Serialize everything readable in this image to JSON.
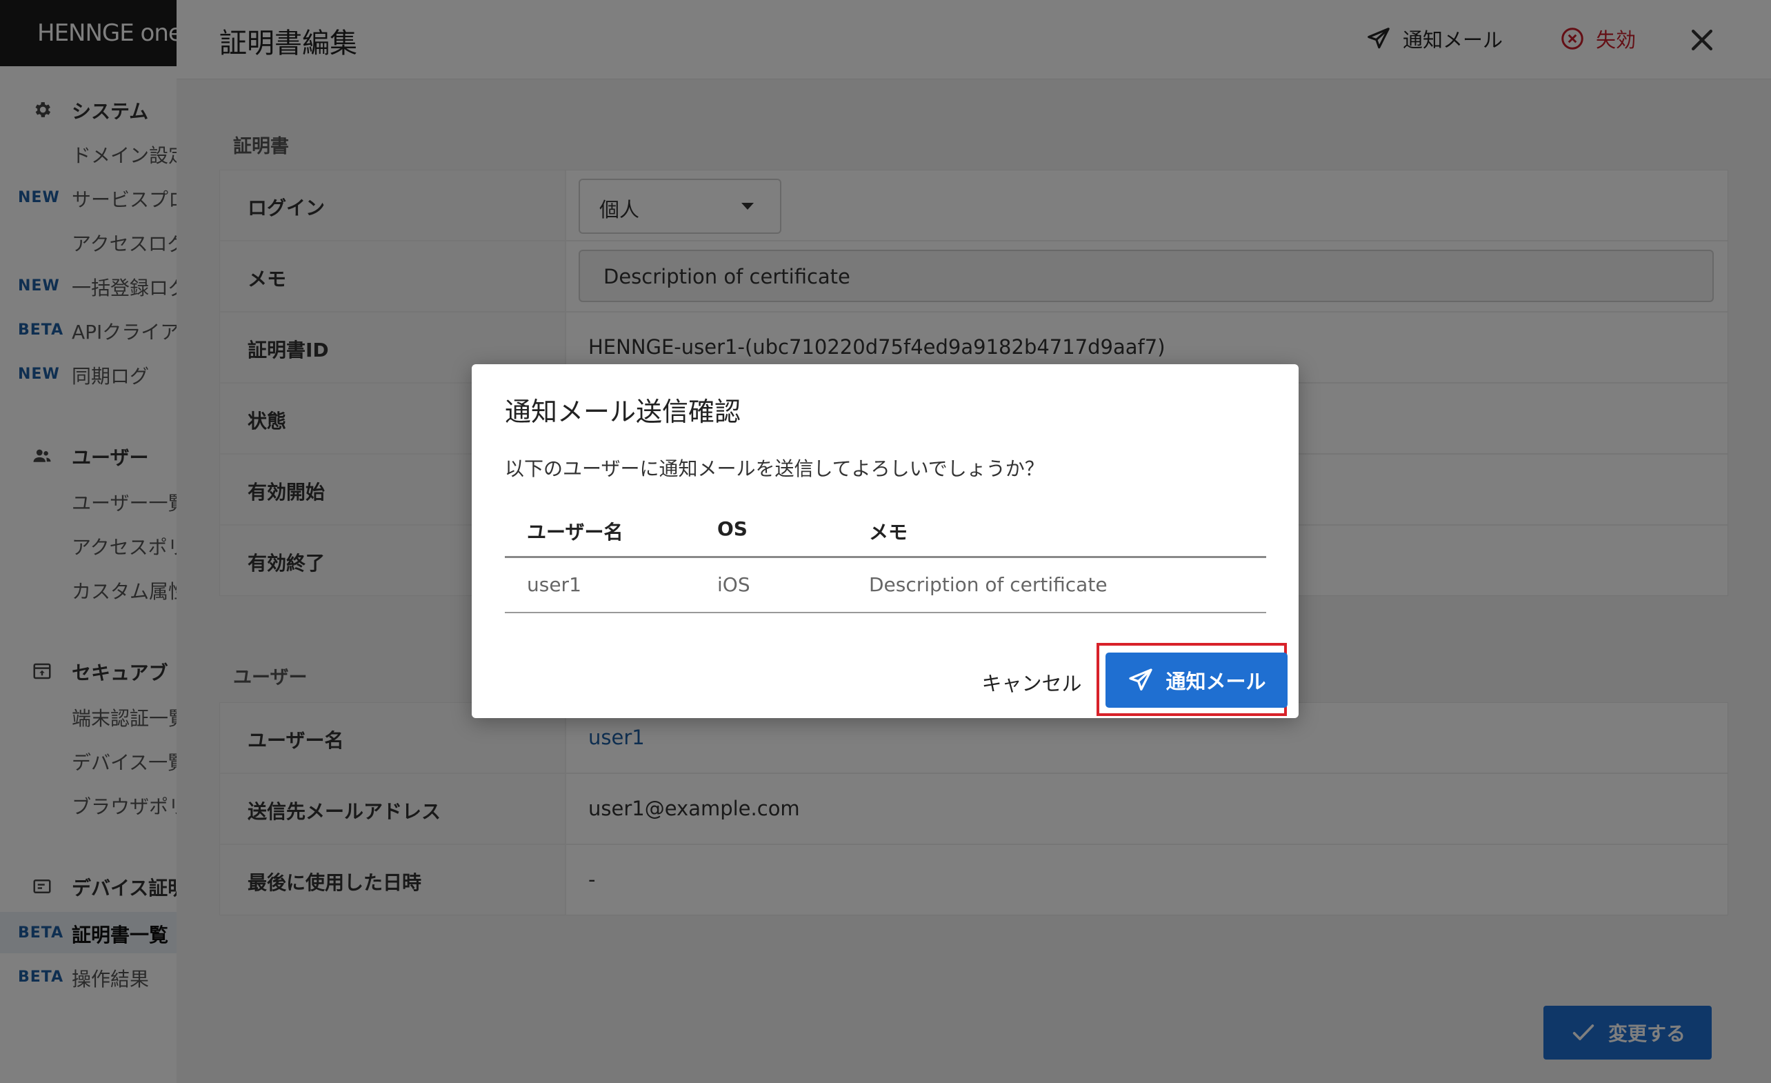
{
  "sidebar": {
    "logo": "HENNGE one",
    "sections": [
      {
        "icon": "gear-icon",
        "label": "システム"
      },
      {
        "icon": "users-icon",
        "label": "ユーザー"
      },
      {
        "icon": "secure-browser-icon",
        "label": "セキュアブ"
      },
      {
        "icon": "device-cert-icon",
        "label": "デバイス証明"
      }
    ],
    "items": [
      {
        "badge": "",
        "label": "ドメイン設定"
      },
      {
        "badge": "NEW",
        "label": "サービスプロ"
      },
      {
        "badge": "",
        "label": "アクセスログ"
      },
      {
        "badge": "NEW",
        "label": "一括登録ログ"
      },
      {
        "badge": "BETA",
        "label": "APIクライア"
      },
      {
        "badge": "NEW",
        "label": "同期ログ"
      },
      {
        "badge": "",
        "label": "ユーザー一覧"
      },
      {
        "badge": "",
        "label": "アクセスポリ"
      },
      {
        "badge": "",
        "label": "カスタム属性"
      },
      {
        "badge": "",
        "label": "端末認証一覧"
      },
      {
        "badge": "",
        "label": "デバイス一覧"
      },
      {
        "badge": "",
        "label": "ブラウザポリ"
      },
      {
        "badge": "BETA",
        "label": "証明書一覧"
      },
      {
        "badge": "BETA",
        "label": "操作結果"
      }
    ]
  },
  "drawer": {
    "title": "証明書編集",
    "notify_label": "通知メール",
    "revoke_label": "失効",
    "certificate_section": "証明書",
    "certificate_rows": {
      "login": {
        "label": "ログイン",
        "value": "個人"
      },
      "memo": {
        "label": "メモ",
        "value": "Description of certificate"
      },
      "cert_id": {
        "label": "証明書ID",
        "value": "HENNGE-user1-(ubc710220d75f4ed9a9182b4717d9aaf7)"
      },
      "status": {
        "label": "状態"
      },
      "valid_from": {
        "label": "有効開始"
      },
      "valid_to": {
        "label": "有効終了"
      }
    },
    "user_section": "ユーザー",
    "user_rows": {
      "username": {
        "label": "ユーザー名",
        "value": "user1"
      },
      "email": {
        "label": "送信先メールアドレス",
        "value": "user1@example.com"
      },
      "last_used": {
        "label": "最後に使用した日時",
        "value": "-"
      }
    },
    "submit_label": "変更する"
  },
  "modal": {
    "title": "通知メール送信確認",
    "message": "以下のユーザーに通知メールを送信してよろしいでしょうか？",
    "columns": {
      "username": "ユーザー名",
      "os": "OS",
      "memo": "メモ"
    },
    "rows": [
      {
        "username": "user1",
        "os": "iOS",
        "memo": "Description of certificate"
      }
    ],
    "cancel_label": "キャンセル",
    "send_label": "通知メール"
  },
  "colors": {
    "primary": "#1f6fd1",
    "danger": "#c81e2a",
    "highlight": "#d8222a",
    "badge": "#1f5fa3"
  }
}
